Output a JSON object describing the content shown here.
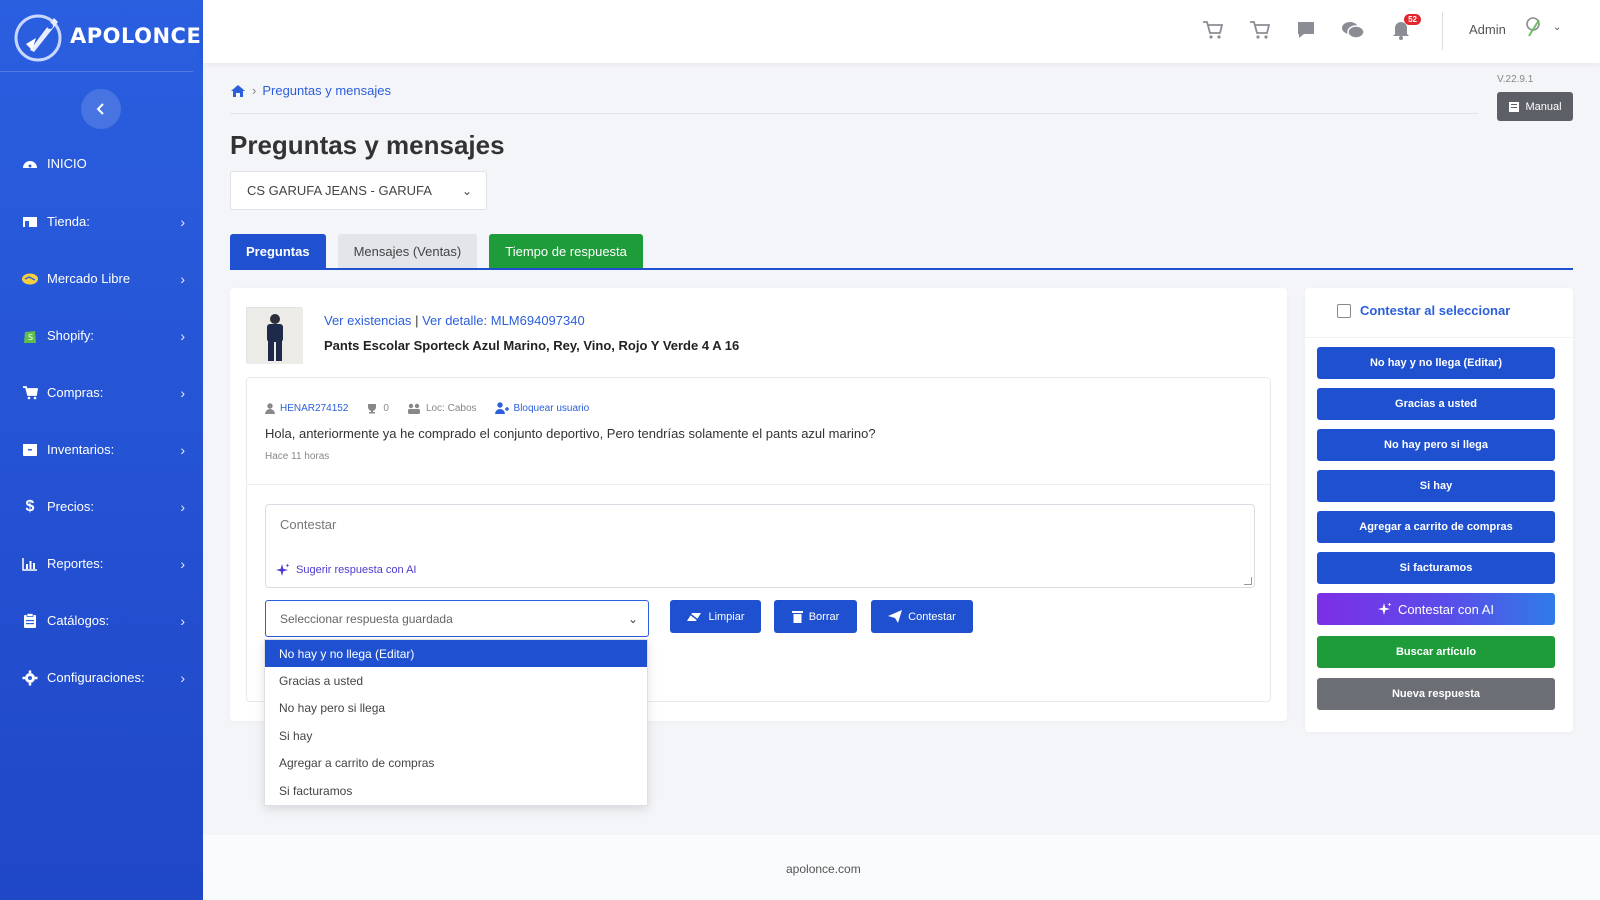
{
  "brand": {
    "name": "APOLONCE"
  },
  "sidebar": {
    "items": [
      {
        "label": "INICIO",
        "icon": "dashboard-icon",
        "has_children": false
      },
      {
        "label": "Tienda:",
        "icon": "store-icon",
        "has_children": true
      },
      {
        "label": "Mercado Libre",
        "icon": "handshake-icon",
        "has_children": true
      },
      {
        "label": "Shopify:",
        "icon": "shopify-icon",
        "has_children": true
      },
      {
        "label": "Compras:",
        "icon": "cart-icon",
        "has_children": true
      },
      {
        "label": "Inventarios:",
        "icon": "inventory-icon",
        "has_children": true
      },
      {
        "label": "Precios:",
        "icon": "dollar-icon",
        "has_children": true
      },
      {
        "label": "Reportes:",
        "icon": "chart-icon",
        "has_children": true
      },
      {
        "label": "Catálogos:",
        "icon": "clipboard-icon",
        "has_children": true
      },
      {
        "label": "Configuraciones:",
        "icon": "gear-icon",
        "has_children": true
      }
    ]
  },
  "topbar": {
    "notifications_count": "52",
    "user": "Admin"
  },
  "version": "V.22.9.1",
  "manual_label": "Manual",
  "breadcrumb": {
    "current": "Preguntas y mensajes"
  },
  "page_title": "Preguntas y mensajes",
  "store_select": {
    "value": "CS GARUFA JEANS - GARUFA"
  },
  "tabs": [
    {
      "label": "Preguntas",
      "state": "active"
    },
    {
      "label": "Mensajes (Ventas)",
      "state": "inactive"
    },
    {
      "label": "Tiempo de respuesta",
      "state": "highlight"
    }
  ],
  "question": {
    "link_stock": "Ver existencias",
    "separator": "|",
    "link_detail": "Ver detalle: MLM694097340",
    "product_title": "Pants Escolar Sporteck Azul Marino, Rey, Vino, Rojo Y Verde 4 A 16",
    "user": "HENAR274152",
    "trophies": "0",
    "location": "Loc: Cabos",
    "block_user": "Bloquear usuario",
    "text": "Hola, anteriormente ya he comprado el conjunto deportivo, Pero tendrías solamente el pants azul marino?",
    "time": "Hace 11 horas"
  },
  "answer": {
    "placeholder": "Contestar",
    "ai_suggest": "Sugerir respuesta con AI",
    "saved_placeholder": "Seleccionar respuesta guardada",
    "btn_clear": "Limpiar",
    "btn_delete": "Borrar",
    "btn_answer": "Contestar"
  },
  "saved_options": [
    "No hay y no llega (Editar)",
    "Gracias a usted",
    "No hay pero si llega",
    "Si hay",
    "Agregar a carrito de compras",
    "Si facturamos"
  ],
  "right_panel": {
    "checkbox_label": "Contestar al seleccionar",
    "checked": false,
    "quick_buttons": [
      "No hay y no llega (Editar)",
      "Gracias a usted",
      "No hay pero si llega",
      "Si hay",
      "Agregar a carrito de compras",
      "Si facturamos"
    ],
    "ai_button": "Contestar con AI",
    "search_button": "Buscar artículo",
    "new_button": "Nueva respuesta"
  },
  "footer": "apolonce.com",
  "colors": {
    "sidebar": "#2a5fe0",
    "primary": "#1e50cf",
    "success": "#1e9c3a",
    "secondary": "#6b6e74",
    "badge": "#e3262d"
  }
}
